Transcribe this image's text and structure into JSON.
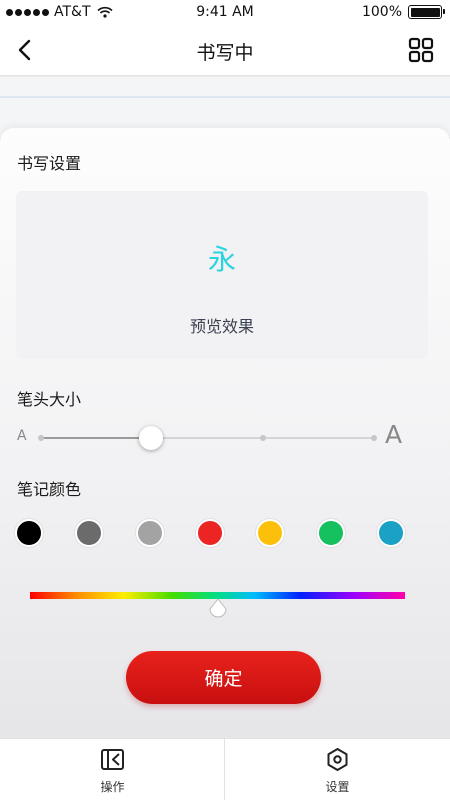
{
  "status_bar": {
    "carrier": "AT&T",
    "time": "9:41 AM",
    "battery": "100%",
    "battery_level": 1.0
  },
  "nav": {
    "title": "书写中",
    "back_icon": "chevron-left-icon",
    "right_icon": "grid-icon"
  },
  "panel": {
    "writing_settings_title": "书写设置",
    "preview": {
      "sample_char": "永",
      "sample_color": "#29d3e0",
      "label": "预览效果"
    },
    "pen_size": {
      "title": "笔头大小",
      "min_label": "A",
      "max_label": "A",
      "value": 0.33
    },
    "pen_color": {
      "title": "笔记颜色",
      "swatches": [
        "#000000",
        "#6b6b6b",
        "#a3a3a3",
        "#ec2424",
        "#fdc00a",
        "#15c05f",
        "#1aa1c4"
      ],
      "hue_value": 0.5
    },
    "confirm_label": "确定"
  },
  "tabs": [
    {
      "label": "操作",
      "icon": "operate-icon"
    },
    {
      "label": "设置",
      "icon": "settings-icon"
    }
  ]
}
